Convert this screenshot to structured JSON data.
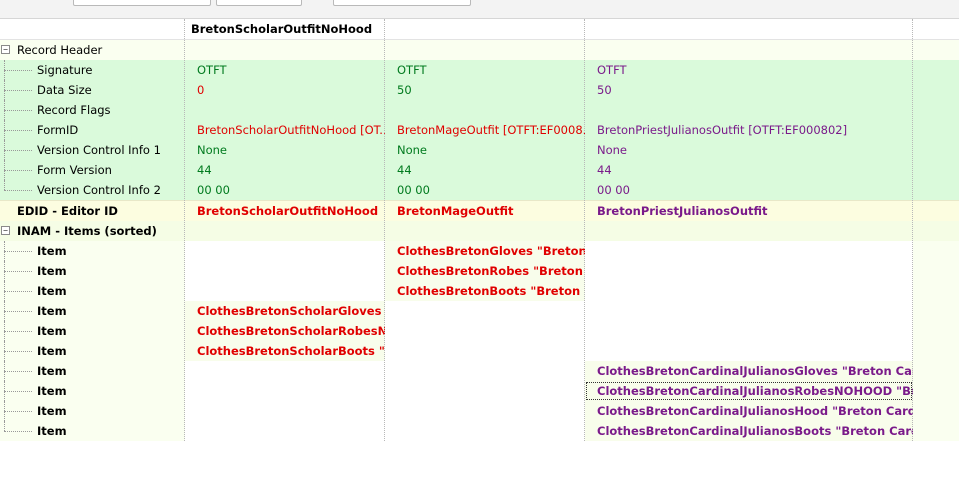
{
  "columns": [
    {
      "title": "BretonScholarOutfitNoHood"
    },
    {
      "title": ""
    },
    {
      "title": ""
    }
  ],
  "record_header": {
    "label": "Record Header",
    "fields": [
      {
        "label": "Signature",
        "values": [
          "OTFT",
          "OTFT",
          "OTFT"
        ]
      },
      {
        "label": "Data Size",
        "values": [
          "0",
          "50",
          "50"
        ]
      },
      {
        "label": "Record Flags",
        "values": [
          "",
          "",
          ""
        ]
      },
      {
        "label": "FormID",
        "values": [
          "BretonScholarOutfitNoHood [OT...",
          "BretonMageOutfit [OTFT:EF0008...",
          "BretonPriestJulianosOutfit [OTFT:EF000802]"
        ]
      },
      {
        "label": "Version Control Info 1",
        "values": [
          "None",
          "None",
          "None"
        ]
      },
      {
        "label": "Form Version",
        "values": [
          "44",
          "44",
          "44"
        ]
      },
      {
        "label": "Version Control Info 2",
        "values": [
          "00 00",
          "00 00",
          "00 00"
        ]
      }
    ]
  },
  "edid": {
    "label": "EDID - Editor ID",
    "values": [
      "BretonScholarOutfitNoHood",
      "BretonMageOutfit",
      "BretonPriestJulianosOutfit"
    ]
  },
  "inam": {
    "label": "INAM - Items (sorted)",
    "items": [
      {
        "label": "Item",
        "values": [
          "",
          "ClothesBretonGloves \"Breton ...",
          ""
        ]
      },
      {
        "label": "Item",
        "values": [
          "",
          "ClothesBretonRobes \"Breton ...",
          ""
        ]
      },
      {
        "label": "Item",
        "values": [
          "",
          "ClothesBretonBoots \"Breton ...",
          ""
        ]
      },
      {
        "label": "Item",
        "values": [
          "ClothesBretonScholarGloves \"...",
          "",
          ""
        ]
      },
      {
        "label": "Item",
        "values": [
          "ClothesBretonScholarRobesNO...",
          "",
          ""
        ]
      },
      {
        "label": "Item",
        "values": [
          "ClothesBretonScholarBoots \"B...",
          "",
          ""
        ]
      },
      {
        "label": "Item",
        "values": [
          "",
          "",
          "ClothesBretonCardinalJulianosGloves \"Breton Cardinal..."
        ]
      },
      {
        "label": "Item",
        "values": [
          "",
          "",
          "ClothesBretonCardinalJulianosRobesNOHOOD \"Breto..."
        ]
      },
      {
        "label": "Item",
        "values": [
          "",
          "",
          "ClothesBretonCardinalJulianosHood \"Breton Cardinal ..."
        ]
      },
      {
        "label": "Item",
        "values": [
          "",
          "",
          "ClothesBretonCardinalJulianosBoots \"Breton Cardinal ..."
        ]
      }
    ]
  },
  "colors": {
    "unchanged": "#007a1e",
    "conflict": "#e00000",
    "override": "#7a1a8a"
  }
}
